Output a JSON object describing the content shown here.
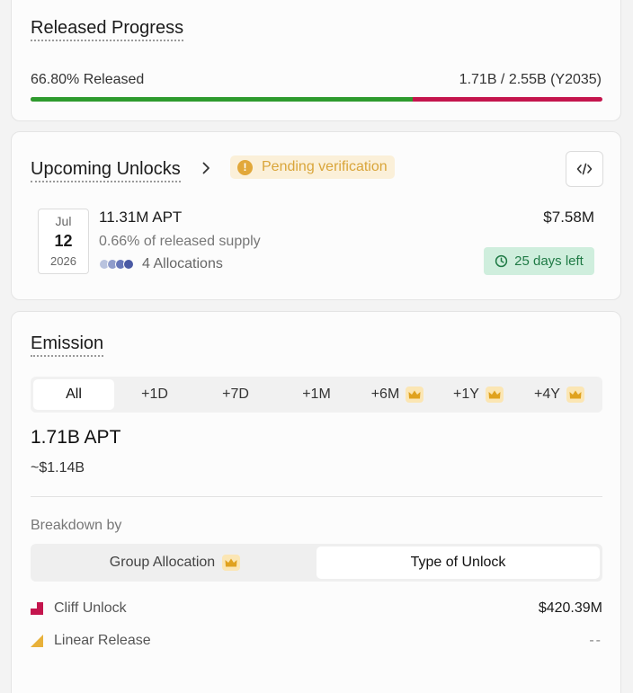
{
  "released_progress": {
    "title": "Released Progress",
    "released_label": "66.80% Released",
    "supply_label": "1.71B / 2.55B (Y2035)",
    "released_fraction": 0.668,
    "colors": {
      "released": "#2e9b2e",
      "locked": "#c4154d"
    }
  },
  "upcoming": {
    "title": "Upcoming Unlocks",
    "chevron_icon": "chevron-right-icon",
    "badge_label": "Pending verification",
    "badge_icon": "warning-icon",
    "embed_icon": "code-icon",
    "event": {
      "month": "Jul",
      "day": "12",
      "year": "2026",
      "amount": "11.31M APT",
      "percent_label": "0.66% of released supply",
      "allocations_label": "4 Allocations",
      "value": "$7.58M",
      "days_left": "25 days left",
      "clock_icon": "clock-icon"
    }
  },
  "emission": {
    "title": "Emission",
    "tabs": [
      {
        "label": "All",
        "active": true,
        "premium": false
      },
      {
        "label": "+1D",
        "active": false,
        "premium": false
      },
      {
        "label": "+7D",
        "active": false,
        "premium": false
      },
      {
        "label": "+1M",
        "active": false,
        "premium": false
      },
      {
        "label": "+6M",
        "active": false,
        "premium": true
      },
      {
        "label": "+1Y",
        "active": false,
        "premium": true
      },
      {
        "label": "+4Y",
        "active": false,
        "premium": true
      }
    ],
    "amount": "1.71B APT",
    "usd": "~$1.14B",
    "breakdown_label": "Breakdown by",
    "breakdown_tabs": [
      {
        "label": "Group Allocation",
        "active": false,
        "premium": true
      },
      {
        "label": "Type of Unlock",
        "active": true,
        "premium": false
      }
    ],
    "legend": [
      {
        "name": "Cliff Unlock",
        "value": "$420.39M",
        "color": "#c4154d",
        "icon": "cliff-unlock-icon"
      },
      {
        "name": "Linear Release",
        "value": "--",
        "color": "#e8b13a",
        "icon": "linear-release-icon"
      }
    ]
  }
}
